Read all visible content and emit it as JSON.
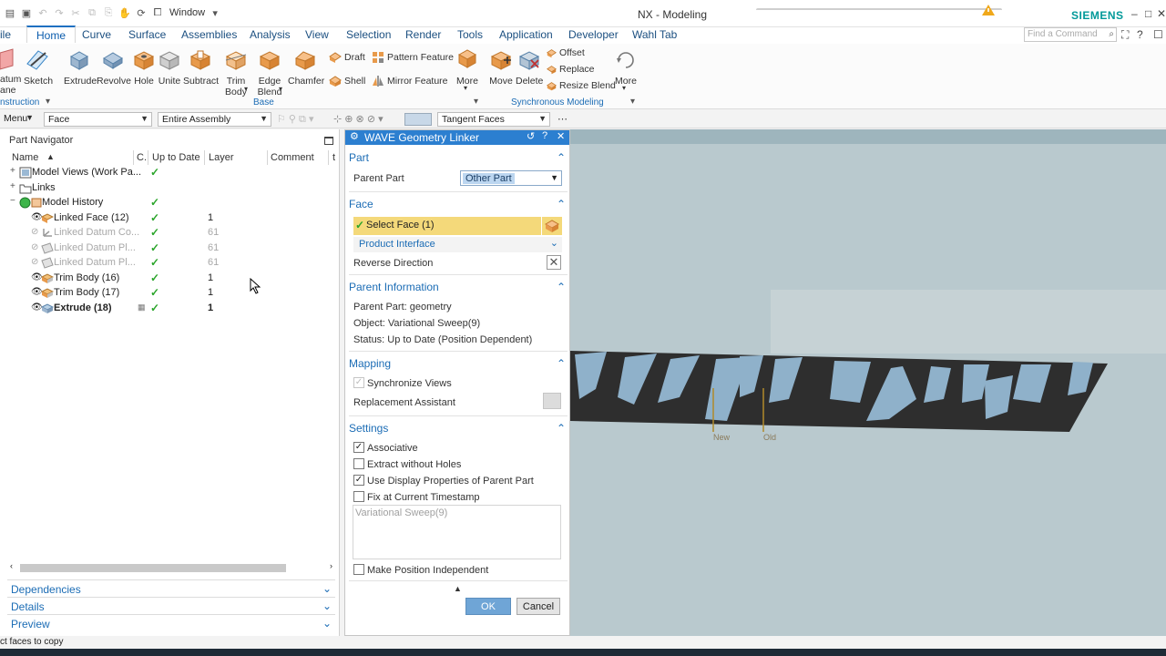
{
  "title_bar": {
    "window_label": "Window",
    "app_title": "NX - Modeling",
    "brand": "SIEMENS",
    "win_controls": [
      "–",
      "□",
      "✕"
    ]
  },
  "menu": {
    "partial_left": "ile",
    "tabs": [
      "Home",
      "Curve",
      "Surface",
      "Assemblies",
      "Analysis",
      "View",
      "Selection",
      "Render",
      "Tools",
      "Application",
      "Developer",
      "Wahl Tab"
    ],
    "active_tab": "Home",
    "search_placeholder": "Find a Command"
  },
  "ribbon": {
    "partial_datum_top": "atum",
    "partial_datum_bottom": "ane",
    "sketch": "Sketch",
    "construction_label": "nstruction",
    "extrude": "Extrude",
    "revolve": "Revolve",
    "hole": "Hole",
    "unite": "Unite",
    "subtract": "Subtract",
    "trim_body_1": "Trim",
    "trim_body_2": "Body",
    "edge_blend_1": "Edge",
    "edge_blend_2": "Blend",
    "chamfer": "Chamfer",
    "draft": "Draft",
    "shell": "Shell",
    "pattern_feature": "Pattern Feature",
    "mirror_feature": "Mirror Feature",
    "more": "More",
    "base_label": "Base",
    "move": "Move",
    "delete": "Delete",
    "offset": "Offset",
    "replace": "Replace",
    "resize_blend": "Resize Blend",
    "sync_label": "Synchronous Modeling",
    "more2": "More"
  },
  "selection_bar": {
    "menu": "Menu",
    "filter": "Face",
    "scope": "Entire Assembly",
    "rule": "Tangent Faces"
  },
  "navigator": {
    "title": "Part Navigator",
    "columns": [
      "Name",
      "C.",
      "Up to Date",
      "Layer",
      "Comment",
      "t"
    ],
    "rows": [
      {
        "name": "Model Views (Work Pa...",
        "check": "✓",
        "layer": ""
      },
      {
        "name": "Links",
        "check": "",
        "layer": ""
      },
      {
        "name": "Model History",
        "check": "✓",
        "layer": ""
      },
      {
        "name": "Linked Face (12)",
        "check": "✓",
        "layer": "1"
      },
      {
        "name": "Linked Datum Co...",
        "check": "✓",
        "layer": "61"
      },
      {
        "name": "Linked Datum Pl...",
        "check": "✓",
        "layer": "61"
      },
      {
        "name": "Linked Datum Pl...",
        "check": "✓",
        "layer": "61"
      },
      {
        "name": "Trim Body (16)",
        "check": "✓",
        "layer": "1"
      },
      {
        "name": "Trim Body (17)",
        "check": "✓",
        "layer": "1"
      },
      {
        "name": "Extrude (18)",
        "check": "✓",
        "layer": "1"
      }
    ],
    "sections": [
      "Dependencies",
      "Details",
      "Preview"
    ]
  },
  "dialog": {
    "title": "WAVE Geometry Linker",
    "part_section": "Part",
    "parent_part_label": "Parent Part",
    "parent_part_value": "Other Part",
    "face_section": "Face",
    "select_face": "Select Face (1)",
    "product_interface": "Product Interface",
    "reverse_direction": "Reverse Direction",
    "parent_info_section": "Parent Information",
    "parent_part_info": "Parent Part: geometry",
    "object_info": "Object: Variational Sweep(9)",
    "status_info": "Status: Up to Date (Position Dependent)",
    "mapping_section": "Mapping",
    "synchronize_views": "Synchronize Views",
    "replacement_assistant": "Replacement Assistant",
    "settings_section": "Settings",
    "associative": "Associative",
    "extract_without_holes": "Extract without Holes",
    "use_display_props": "Use Display Properties of Parent Part",
    "fix_timestamp": "Fix at Current Timestamp",
    "notes_text": "Variational Sweep(9)",
    "make_position_independent": "Make Position Independent",
    "ok": "OK",
    "cancel": "Cancel"
  },
  "viewport": {
    "label_new": "New",
    "label_old": "Old"
  },
  "status": {
    "message": "ct faces to copy"
  },
  "colors": {
    "accent": "#1f70c1",
    "dialog_header": "#2c7fd0",
    "highlight": "#f4d97a",
    "viewport_bg": "#b9c9ce",
    "body_dark": "#2e2e2e",
    "body_light": "#8fb1ca"
  }
}
